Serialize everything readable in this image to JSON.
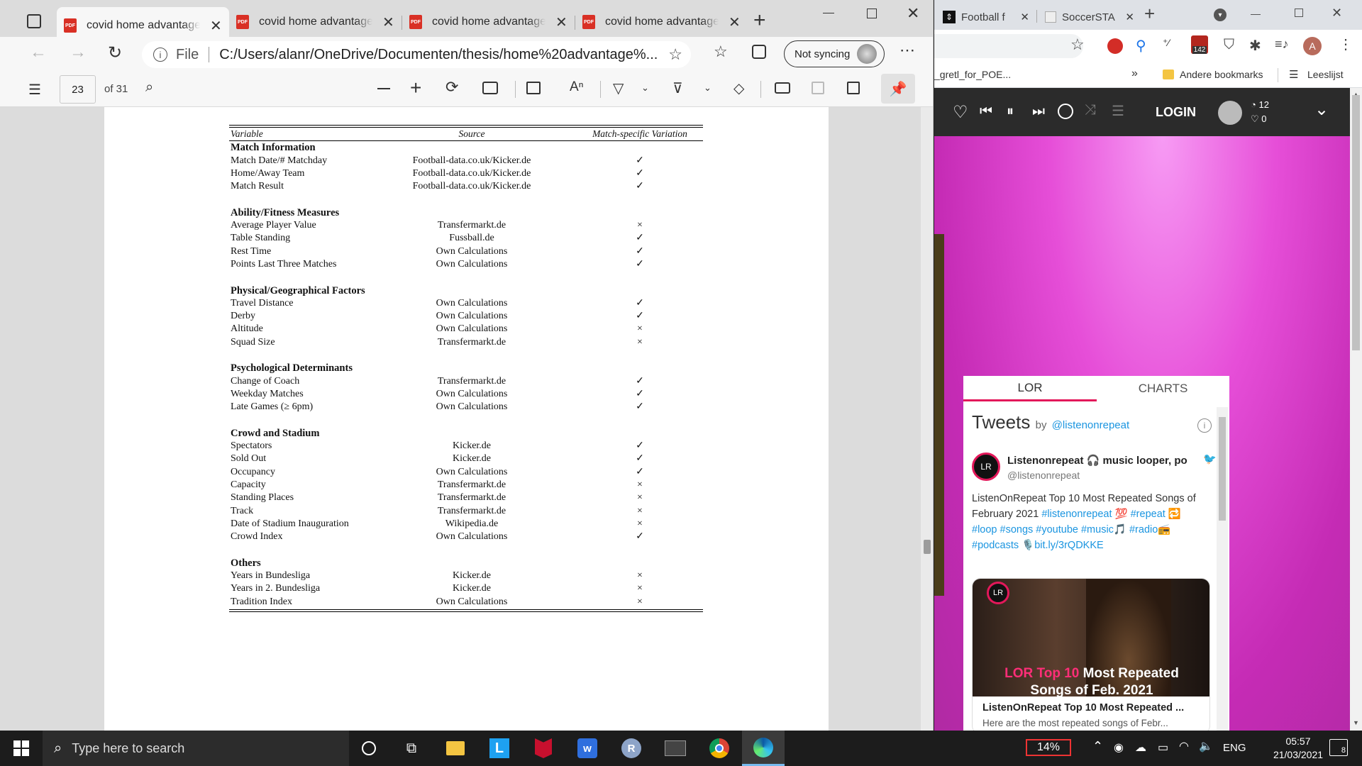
{
  "edge": {
    "tabs": [
      {
        "title": "covid home advantage p",
        "active": true
      },
      {
        "title": "covid home advantage p",
        "active": false
      },
      {
        "title": "covid home advantage p",
        "active": false
      },
      {
        "title": "covid home advantage p",
        "active": false
      }
    ],
    "pdf_badge": "PDF",
    "address": {
      "file_label": "File",
      "url": "C:/Users/alanr/OneDrive/Documenten/thesis/home%20advantage%...",
      "sync_label": "Not syncing"
    },
    "pdf_toolbar": {
      "page_number": "23",
      "page_total": "of 31"
    }
  },
  "table": {
    "headers": {
      "variable": "Variable",
      "source": "Source",
      "variation": "Match-specific Variation"
    },
    "sections": [
      {
        "title": "Match Information",
        "rows": [
          {
            "variable": "Match Date/# Matchday",
            "source": "Football-data.co.uk/Kicker.de",
            "mark": "✓"
          },
          {
            "variable": "Home/Away Team",
            "source": "Football-data.co.uk/Kicker.de",
            "mark": "✓"
          },
          {
            "variable": "Match Result",
            "source": "Football-data.co.uk/Kicker.de",
            "mark": "✓"
          }
        ]
      },
      {
        "title": "Ability/Fitness Measures",
        "rows": [
          {
            "variable": "Average Player Value",
            "source": "Transfermarkt.de",
            "mark": "×"
          },
          {
            "variable": "Table Standing",
            "source": "Fussball.de",
            "mark": "✓"
          },
          {
            "variable": "Rest Time",
            "source": "Own Calculations",
            "mark": "✓"
          },
          {
            "variable": "Points Last Three Matches",
            "source": "Own Calculations",
            "mark": "✓"
          }
        ]
      },
      {
        "title": "Physical/Geographical Factors",
        "rows": [
          {
            "variable": "Travel Distance",
            "source": "Own Calculations",
            "mark": "✓"
          },
          {
            "variable": "Derby",
            "source": "Own Calculations",
            "mark": "✓"
          },
          {
            "variable": "Altitude",
            "source": "Own Calculations",
            "mark": "×"
          },
          {
            "variable": "Squad Size",
            "source": "Transfermarkt.de",
            "mark": "×"
          }
        ]
      },
      {
        "title": "Psychological Determinants",
        "rows": [
          {
            "variable": "Change of Coach",
            "source": "Transfermarkt.de",
            "mark": "✓"
          },
          {
            "variable": "Weekday Matches",
            "source": "Own Calculations",
            "mark": "✓"
          },
          {
            "variable": "Late Games (≥ 6pm)",
            "source": "Own Calculations",
            "mark": "✓"
          }
        ]
      },
      {
        "title": "Crowd and Stadium",
        "rows": [
          {
            "variable": "Spectators",
            "source": "Kicker.de",
            "mark": "✓"
          },
          {
            "variable": "Sold Out",
            "source": "Kicker.de",
            "mark": "✓"
          },
          {
            "variable": "Occupancy",
            "source": "Own Calculations",
            "mark": "✓"
          },
          {
            "variable": "Capacity",
            "source": "Transfermarkt.de",
            "mark": "×"
          },
          {
            "variable": "Standing Places",
            "source": "Transfermarkt.de",
            "mark": "×"
          },
          {
            "variable": "Track",
            "source": "Transfermarkt.de",
            "mark": "×"
          },
          {
            "variable": "Date of Stadium Inauguration",
            "source": "Wikipedia.de",
            "mark": "×"
          },
          {
            "variable": "Crowd Index",
            "source": "Own Calculations",
            "mark": "✓"
          }
        ]
      },
      {
        "title": "Others",
        "rows": [
          {
            "variable": "Years in Bundesliga",
            "source": "Kicker.de",
            "mark": "×"
          },
          {
            "variable": "Years in 2. Bundesliga",
            "source": "Kicker.de",
            "mark": "×"
          },
          {
            "variable": "Tradition Index",
            "source": "Own Calculations",
            "mark": "×"
          }
        ]
      }
    ]
  },
  "chrome": {
    "tabs": [
      {
        "title": "Football f"
      },
      {
        "title": "SoccerSTA"
      }
    ],
    "bookmarks": {
      "partial": "_gretl_for_POE...",
      "more": "»",
      "other": "Andere bookmarks",
      "reading": "Leeslijst"
    },
    "ext_badge": "142",
    "avatar_letter": "A",
    "player": {
      "login": "LOGIN",
      "count_listen": "12",
      "count_like": "0"
    },
    "widget": {
      "tabs": [
        "LOR",
        "CHARTS"
      ],
      "tweets_title": "Tweets",
      "tweets_by": "by",
      "handle_link": "@listenonrepeat",
      "tweet": {
        "avatar": "LR",
        "name": "Listenonrepeat 🎧 music looper, po",
        "handle": "@listenonrepeat",
        "text_1": "ListenOnRepeat Top 10 Most Repeated Songs of February 2021 ",
        "tags_1": "#listenonrepeat 💯 #repeat 🔁",
        "tags_2": "#loop #songs #youtube #music🎵 #radio📻",
        "tags_3": "#podcasts",
        "link": "🎙️bit.ly/3rQDKKE"
      },
      "card": {
        "badge": "LR",
        "headline_accent": "LOR Top 10",
        "headline_rest": " Most Repeated",
        "headline_line2": "Songs of Feb. 2021",
        "title": "ListenOnRepeat Top 10 Most Repeated ...",
        "desc": "Here are the most repeated songs of Febr..."
      }
    }
  },
  "taskbar": {
    "search_placeholder": "Type here to search",
    "battery": "14%",
    "lang": "ENG",
    "time": "05:57",
    "date": "21/03/2021",
    "notifications": "8"
  }
}
